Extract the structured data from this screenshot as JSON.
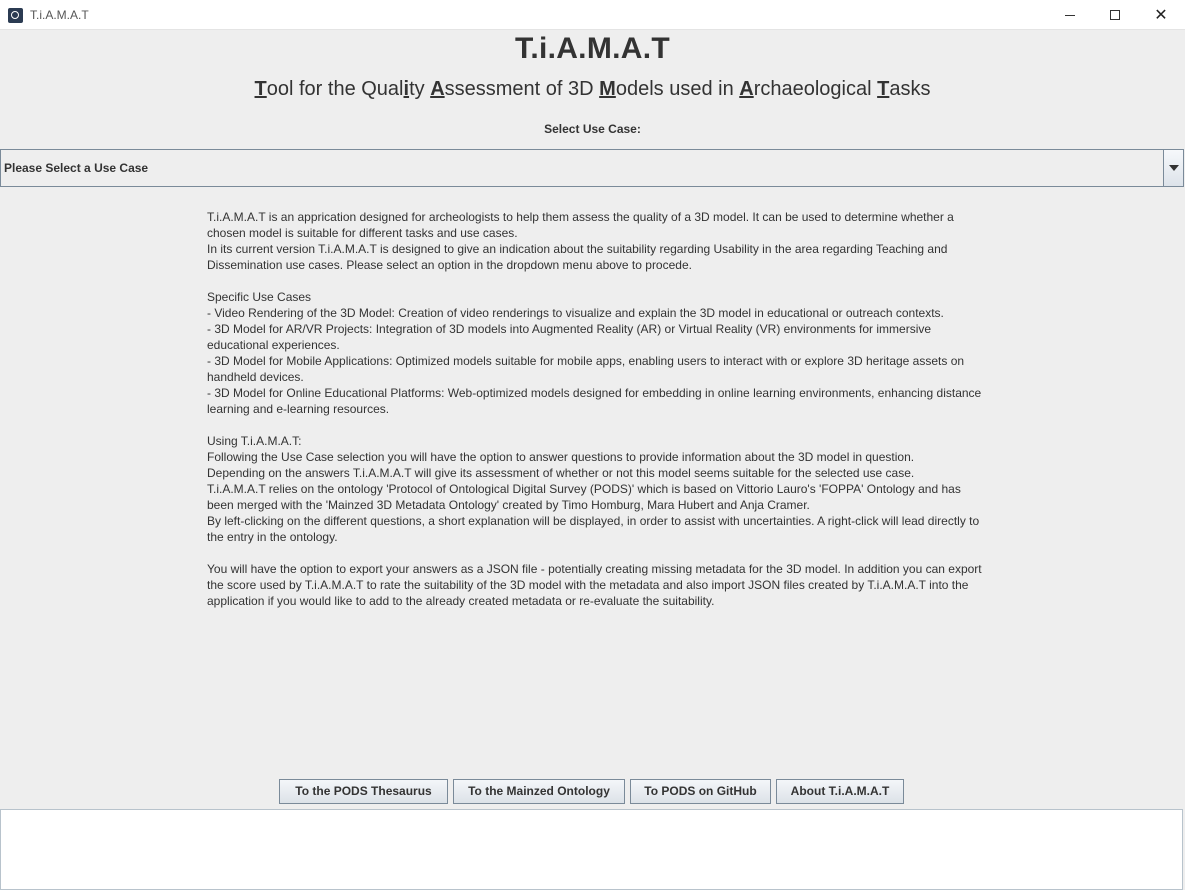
{
  "window": {
    "title": "T.i.A.M.A.T",
    "close_glyph": "✕"
  },
  "header": {
    "title": "T.i.A.M.A.T",
    "subtitle_parts": [
      {
        "u": "T",
        "t": "ool for the Qual"
      },
      {
        "u": "i",
        "t": "ty "
      },
      {
        "u": "A",
        "t": "ssessment of 3D "
      },
      {
        "u": "M",
        "t": "odels used in "
      },
      {
        "u": "A",
        "t": "rchaeological "
      },
      {
        "u": "T",
        "t": "asks"
      }
    ]
  },
  "use_case": {
    "label": "Select Use Case:",
    "selected": "Please Select a Use Case"
  },
  "info": {
    "intro": [
      "T.i.A.M.A.T is an apprication designed for archeologists to help them assess the quality of a 3D model. It can be used to determine whether a chosen model is suitable for different tasks and use cases.",
      "In its current version T.i.A.M.A.T is designed to give an indication about the suitability regarding Usability in the area regarding Teaching and Dissemination use cases. Please select an option in the dropdown menu above to procede."
    ],
    "specific_heading": "Specific Use Cases",
    "specific_items": [
      "- Video Rendering of the 3D Model: Creation of video renderings to visualize and explain the 3D model in educational or outreach contexts.",
      "- 3D Model for AR/VR Projects: Integration of 3D models into Augmented Reality (AR) or Virtual Reality (VR) environments for immersive educational experiences.",
      "- 3D Model for Mobile Applications: Optimized models suitable for mobile apps, enabling users to interact with or explore 3D heritage assets on handheld devices.",
      "- 3D Model for Online Educational Platforms: Web-optimized models designed for embedding in online learning environments, enhancing distance learning and e-learning resources."
    ],
    "using_heading": "Using T.i.A.M.A.T:",
    "using_items": [
      "Following the Use Case selection you will have the option to answer questions to provide information about the 3D model in question.",
      "Depending on the answers T.i.A.M.A.T will give its assessment of whether or not this model seems suitable for the selected use case.",
      "T.i.A.M.A.T relies on the ontology 'Protocol of Ontological Digital Survey (PODS)' which is based on Vittorio Lauro's 'FOPPA' Ontology and has been merged with the 'Mainzed 3D Metadata Ontology' created by Timo Homburg, Mara Hubert and Anja Cramer.",
      "By left-clicking on the different questions, a short explanation will be displayed, in order to assist with uncertainties. A right-click will lead directly to the entry in the ontology."
    ],
    "export_text": "You will have the option to export your answers as a JSON file - potentially creating missing metadata for the 3D model. In addition you can export the score used by T.i.A.M.A.T to rate the suitability of the 3D model with the metadata and also import JSON files created by T.i.A.M.A.T into the application if you would like to add to the already created metadata or re-evaluate the suitability."
  },
  "buttons": {
    "pods_thesaurus": "To the PODS Thesaurus",
    "mainzed_ontology": "To the Mainzed Ontology",
    "pods_github": "To PODS on GitHub",
    "about": "About T.i.A.M.A.T"
  },
  "output": {
    "text": ""
  }
}
